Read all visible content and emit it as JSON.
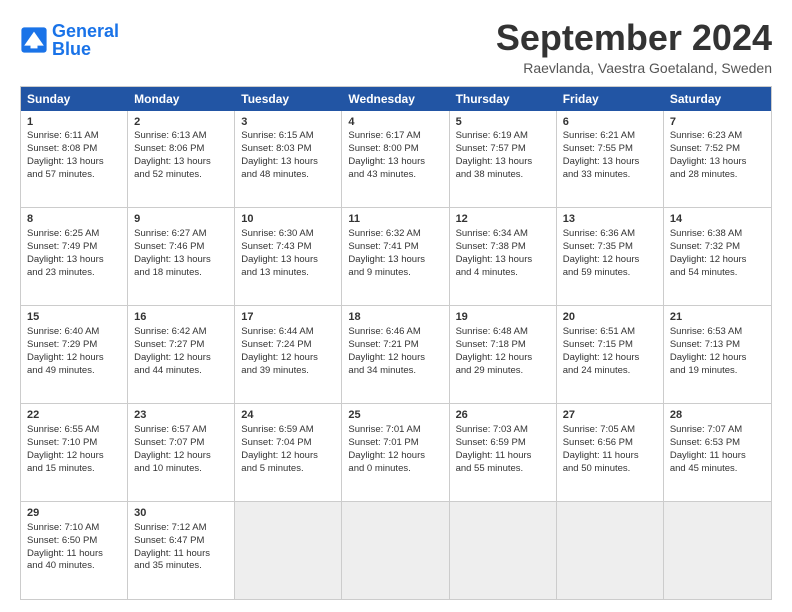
{
  "header": {
    "logo_general": "General",
    "logo_blue": "Blue",
    "title": "September 2024",
    "location": "Raevlanda, Vaestra Goetaland, Sweden"
  },
  "weekdays": [
    "Sunday",
    "Monday",
    "Tuesday",
    "Wednesday",
    "Thursday",
    "Friday",
    "Saturday"
  ],
  "rows": [
    [
      {
        "day": "1",
        "lines": [
          "Sunrise: 6:11 AM",
          "Sunset: 8:08 PM",
          "Daylight: 13 hours",
          "and 57 minutes."
        ]
      },
      {
        "day": "2",
        "lines": [
          "Sunrise: 6:13 AM",
          "Sunset: 8:06 PM",
          "Daylight: 13 hours",
          "and 52 minutes."
        ]
      },
      {
        "day": "3",
        "lines": [
          "Sunrise: 6:15 AM",
          "Sunset: 8:03 PM",
          "Daylight: 13 hours",
          "and 48 minutes."
        ]
      },
      {
        "day": "4",
        "lines": [
          "Sunrise: 6:17 AM",
          "Sunset: 8:00 PM",
          "Daylight: 13 hours",
          "and 43 minutes."
        ]
      },
      {
        "day": "5",
        "lines": [
          "Sunrise: 6:19 AM",
          "Sunset: 7:57 PM",
          "Daylight: 13 hours",
          "and 38 minutes."
        ]
      },
      {
        "day": "6",
        "lines": [
          "Sunrise: 6:21 AM",
          "Sunset: 7:55 PM",
          "Daylight: 13 hours",
          "and 33 minutes."
        ]
      },
      {
        "day": "7",
        "lines": [
          "Sunrise: 6:23 AM",
          "Sunset: 7:52 PM",
          "Daylight: 13 hours",
          "and 28 minutes."
        ]
      }
    ],
    [
      {
        "day": "8",
        "lines": [
          "Sunrise: 6:25 AM",
          "Sunset: 7:49 PM",
          "Daylight: 13 hours",
          "and 23 minutes."
        ]
      },
      {
        "day": "9",
        "lines": [
          "Sunrise: 6:27 AM",
          "Sunset: 7:46 PM",
          "Daylight: 13 hours",
          "and 18 minutes."
        ]
      },
      {
        "day": "10",
        "lines": [
          "Sunrise: 6:30 AM",
          "Sunset: 7:43 PM",
          "Daylight: 13 hours",
          "and 13 minutes."
        ]
      },
      {
        "day": "11",
        "lines": [
          "Sunrise: 6:32 AM",
          "Sunset: 7:41 PM",
          "Daylight: 13 hours",
          "and 9 minutes."
        ]
      },
      {
        "day": "12",
        "lines": [
          "Sunrise: 6:34 AM",
          "Sunset: 7:38 PM",
          "Daylight: 13 hours",
          "and 4 minutes."
        ]
      },
      {
        "day": "13",
        "lines": [
          "Sunrise: 6:36 AM",
          "Sunset: 7:35 PM",
          "Daylight: 12 hours",
          "and 59 minutes."
        ]
      },
      {
        "day": "14",
        "lines": [
          "Sunrise: 6:38 AM",
          "Sunset: 7:32 PM",
          "Daylight: 12 hours",
          "and 54 minutes."
        ]
      }
    ],
    [
      {
        "day": "15",
        "lines": [
          "Sunrise: 6:40 AM",
          "Sunset: 7:29 PM",
          "Daylight: 12 hours",
          "and 49 minutes."
        ]
      },
      {
        "day": "16",
        "lines": [
          "Sunrise: 6:42 AM",
          "Sunset: 7:27 PM",
          "Daylight: 12 hours",
          "and 44 minutes."
        ]
      },
      {
        "day": "17",
        "lines": [
          "Sunrise: 6:44 AM",
          "Sunset: 7:24 PM",
          "Daylight: 12 hours",
          "and 39 minutes."
        ]
      },
      {
        "day": "18",
        "lines": [
          "Sunrise: 6:46 AM",
          "Sunset: 7:21 PM",
          "Daylight: 12 hours",
          "and 34 minutes."
        ]
      },
      {
        "day": "19",
        "lines": [
          "Sunrise: 6:48 AM",
          "Sunset: 7:18 PM",
          "Daylight: 12 hours",
          "and 29 minutes."
        ]
      },
      {
        "day": "20",
        "lines": [
          "Sunrise: 6:51 AM",
          "Sunset: 7:15 PM",
          "Daylight: 12 hours",
          "and 24 minutes."
        ]
      },
      {
        "day": "21",
        "lines": [
          "Sunrise: 6:53 AM",
          "Sunset: 7:13 PM",
          "Daylight: 12 hours",
          "and 19 minutes."
        ]
      }
    ],
    [
      {
        "day": "22",
        "lines": [
          "Sunrise: 6:55 AM",
          "Sunset: 7:10 PM",
          "Daylight: 12 hours",
          "and 15 minutes."
        ]
      },
      {
        "day": "23",
        "lines": [
          "Sunrise: 6:57 AM",
          "Sunset: 7:07 PM",
          "Daylight: 12 hours",
          "and 10 minutes."
        ]
      },
      {
        "day": "24",
        "lines": [
          "Sunrise: 6:59 AM",
          "Sunset: 7:04 PM",
          "Daylight: 12 hours",
          "and 5 minutes."
        ]
      },
      {
        "day": "25",
        "lines": [
          "Sunrise: 7:01 AM",
          "Sunset: 7:01 PM",
          "Daylight: 12 hours",
          "and 0 minutes."
        ]
      },
      {
        "day": "26",
        "lines": [
          "Sunrise: 7:03 AM",
          "Sunset: 6:59 PM",
          "Daylight: 11 hours",
          "and 55 minutes."
        ]
      },
      {
        "day": "27",
        "lines": [
          "Sunrise: 7:05 AM",
          "Sunset: 6:56 PM",
          "Daylight: 11 hours",
          "and 50 minutes."
        ]
      },
      {
        "day": "28",
        "lines": [
          "Sunrise: 7:07 AM",
          "Sunset: 6:53 PM",
          "Daylight: 11 hours",
          "and 45 minutes."
        ]
      }
    ],
    [
      {
        "day": "29",
        "lines": [
          "Sunrise: 7:10 AM",
          "Sunset: 6:50 PM",
          "Daylight: 11 hours",
          "and 40 minutes."
        ]
      },
      {
        "day": "30",
        "lines": [
          "Sunrise: 7:12 AM",
          "Sunset: 6:47 PM",
          "Daylight: 11 hours",
          "and 35 minutes."
        ]
      },
      {
        "day": "",
        "lines": [],
        "empty": true
      },
      {
        "day": "",
        "lines": [],
        "empty": true
      },
      {
        "day": "",
        "lines": [],
        "empty": true
      },
      {
        "day": "",
        "lines": [],
        "empty": true
      },
      {
        "day": "",
        "lines": [],
        "empty": true
      }
    ]
  ]
}
